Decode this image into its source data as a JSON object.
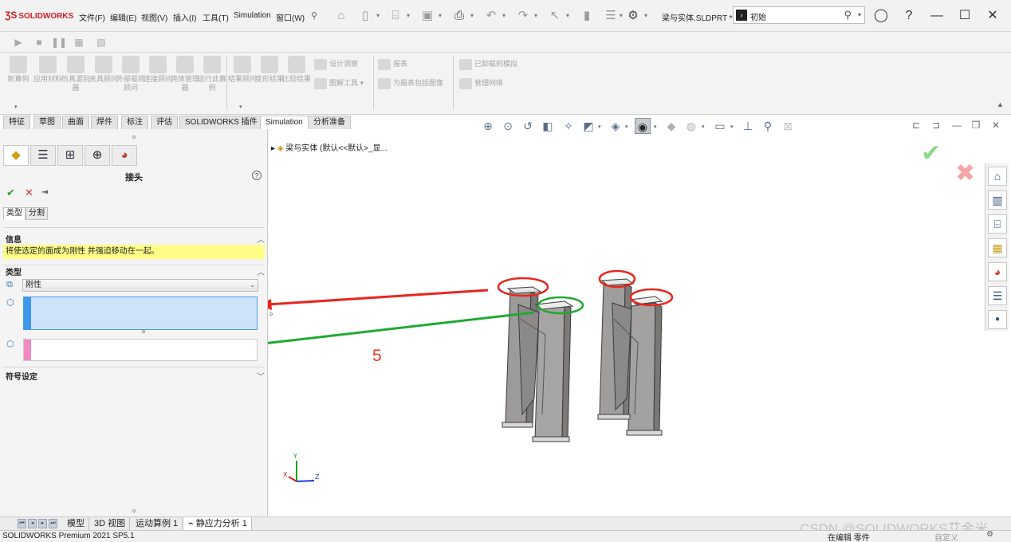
{
  "app": {
    "logo_text": "SOLIDWORKS",
    "doc_title": "梁与实体.SLDPRT *",
    "menus": [
      "文件(F)",
      "编辑(E)",
      "视图(V)",
      "插入(I)",
      "工具(T)",
      "Simulation",
      "窗口(W)"
    ],
    "search_text": "初始"
  },
  "ribbon": {
    "buttons": [
      "新算例",
      "应用材料",
      "仿真源别器",
      "夹具顾问",
      "外部载荷顾问",
      "连接顾问",
      "壳体管理器",
      "运行此算例",
      "结果顾问",
      "变形结果",
      "比较结果"
    ],
    "small": {
      "design_insight": "设计洞察",
      "plot_tools": "图解工具",
      "report": "报表",
      "include_image": "为报表包括图像",
      "unloaded_sim": "已卸载的模拟",
      "manage_network": "管理网络"
    }
  },
  "command_tabs": [
    "特征",
    "草图",
    "曲面",
    "焊件",
    "标注",
    "评估",
    "SOLIDWORKS 插件",
    "Simulation",
    "分析准备"
  ],
  "panel": {
    "title": "接头",
    "subtabs": [
      "类型",
      "分割"
    ],
    "info_header": "信息",
    "info_text": "将使选定的面成为刚性 并强迫移动在一起。",
    "type_header": "类型",
    "type_value": "刚性",
    "symbol_header": "符号设定"
  },
  "graphics": {
    "tree_label": "梁与实体 (默认<<默认>_显...",
    "annotation_number": "5"
  },
  "bottom_tabs": [
    "模型",
    "3D 视图",
    "运动算例 1",
    "静应力分析 1"
  ],
  "status": {
    "product": "SOLIDWORKS Premium 2021 SP5.1",
    "editing": "在编辑 零件",
    "custom": "自定义",
    "watermark": "CSDN @SOLIDWORKS艾金米"
  },
  "colors": {
    "brand": "#d0202a",
    "info_bg": "#ffff88",
    "selection_face_bar": "#3d98ee",
    "selection_face_bg": "#cde3f9",
    "selection_face2_bar": "#f08ac0",
    "annotation_red": "#e8361e",
    "annotation_green": "#22a832"
  }
}
